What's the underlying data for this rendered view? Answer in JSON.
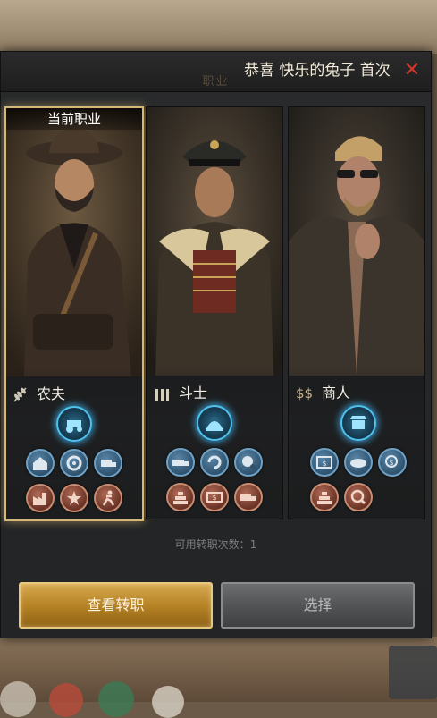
{
  "dialog": {
    "title": "职业",
    "marquee_text": "恭喜 快乐的兔子 首次",
    "close_symbol": "✕",
    "transfer_count_text": "可用转职次数：1"
  },
  "cards": [
    {
      "name": "农夫",
      "current_label": "当前职业",
      "is_current": true,
      "role_icon": "wheat-icon",
      "main_skill": "farm-tractor-icon",
      "skills_row1": [
        "barn-icon",
        "gear-icon",
        "truck-icon"
      ],
      "skills_row2": [
        "factory-icon",
        "badge-star-icon",
        "runner-icon"
      ]
    },
    {
      "name": "斗士",
      "is_current": false,
      "role_icon": "bullets-icon",
      "main_skill": "dome-icon",
      "skills_row1": [
        "supply-truck-icon",
        "refresh-icon",
        "globe-icon"
      ],
      "skills_row2": [
        "gold-bars-icon",
        "money-icon",
        "transport-truck-icon"
      ]
    },
    {
      "name": "商人",
      "is_current": false,
      "role_icon": "dollar-sign-icon",
      "role_icon_text": "$$",
      "main_skill": "shop-icon",
      "skills_row1": [
        "bill-icon",
        "bread-icon",
        "coin-plus-icon"
      ],
      "skills_row2": [
        "gold-bars-icon",
        "search-coin-icon"
      ]
    }
  ],
  "buttons": {
    "view_transfer": "查看转职",
    "select": "选择"
  },
  "colors": {
    "gold_border": "#d8b774",
    "close_red": "#d2352b",
    "skill_glow": "#4fc3f0"
  }
}
